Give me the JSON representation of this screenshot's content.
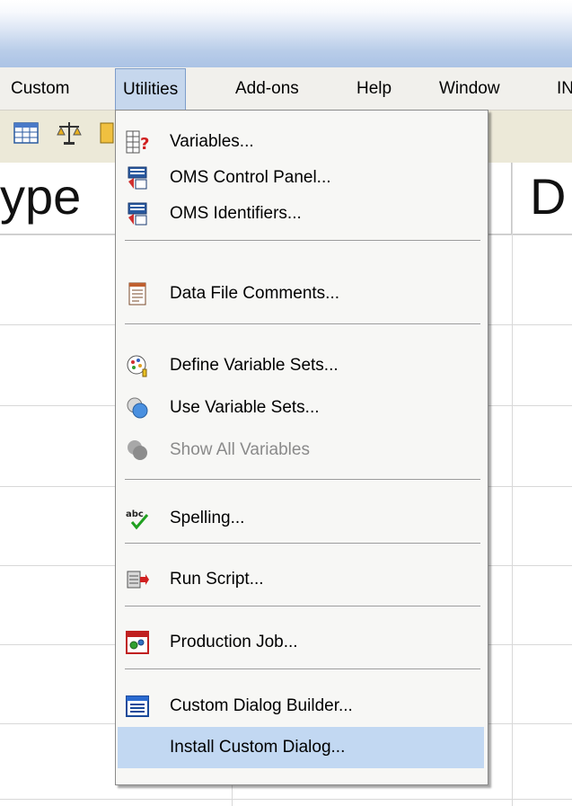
{
  "menubar": {
    "items": [
      {
        "label": "Custom"
      },
      {
        "label": "Utilities"
      },
      {
        "label": "Add-ons"
      },
      {
        "label": "Help"
      },
      {
        "label": "Window"
      },
      {
        "label": "IN"
      }
    ]
  },
  "grid": {
    "headers": [
      {
        "label": "ype"
      },
      {
        "label": "D"
      }
    ]
  },
  "utilities_menu": {
    "items": [
      {
        "label": "Variables...",
        "icon": "variables-icon",
        "enabled": true
      },
      {
        "label": "OMS Control Panel...",
        "icon": "oms-control-panel-icon",
        "enabled": true
      },
      {
        "label": "OMS Identifiers...",
        "icon": "oms-identifiers-icon",
        "enabled": true
      },
      {
        "label": "Data File Comments...",
        "icon": "data-file-comments-icon",
        "enabled": true
      },
      {
        "label": "Define Variable Sets...",
        "icon": "define-variable-sets-icon",
        "enabled": true
      },
      {
        "label": "Use Variable Sets...",
        "icon": "use-variable-sets-icon",
        "enabled": true
      },
      {
        "label": "Show All Variables",
        "icon": "show-all-variables-icon",
        "enabled": false
      },
      {
        "label": "Spelling...",
        "icon": "spelling-icon",
        "enabled": true
      },
      {
        "label": "Run Script...",
        "icon": "run-script-icon",
        "enabled": true
      },
      {
        "label": "Production Job...",
        "icon": "production-job-icon",
        "enabled": true
      },
      {
        "label": "Custom Dialog Builder...",
        "icon": "custom-dialog-builder-icon",
        "enabled": true
      },
      {
        "label": "Install Custom Dialog...",
        "icon": "",
        "enabled": true,
        "highlighted": true
      }
    ]
  },
  "colors": {
    "menu_highlight": "#c2d8f2",
    "menu_open_border": "#7d9dcb",
    "disabled_text": "#8a8a8a",
    "title_bar_gradient_end": "#abc3e5"
  }
}
